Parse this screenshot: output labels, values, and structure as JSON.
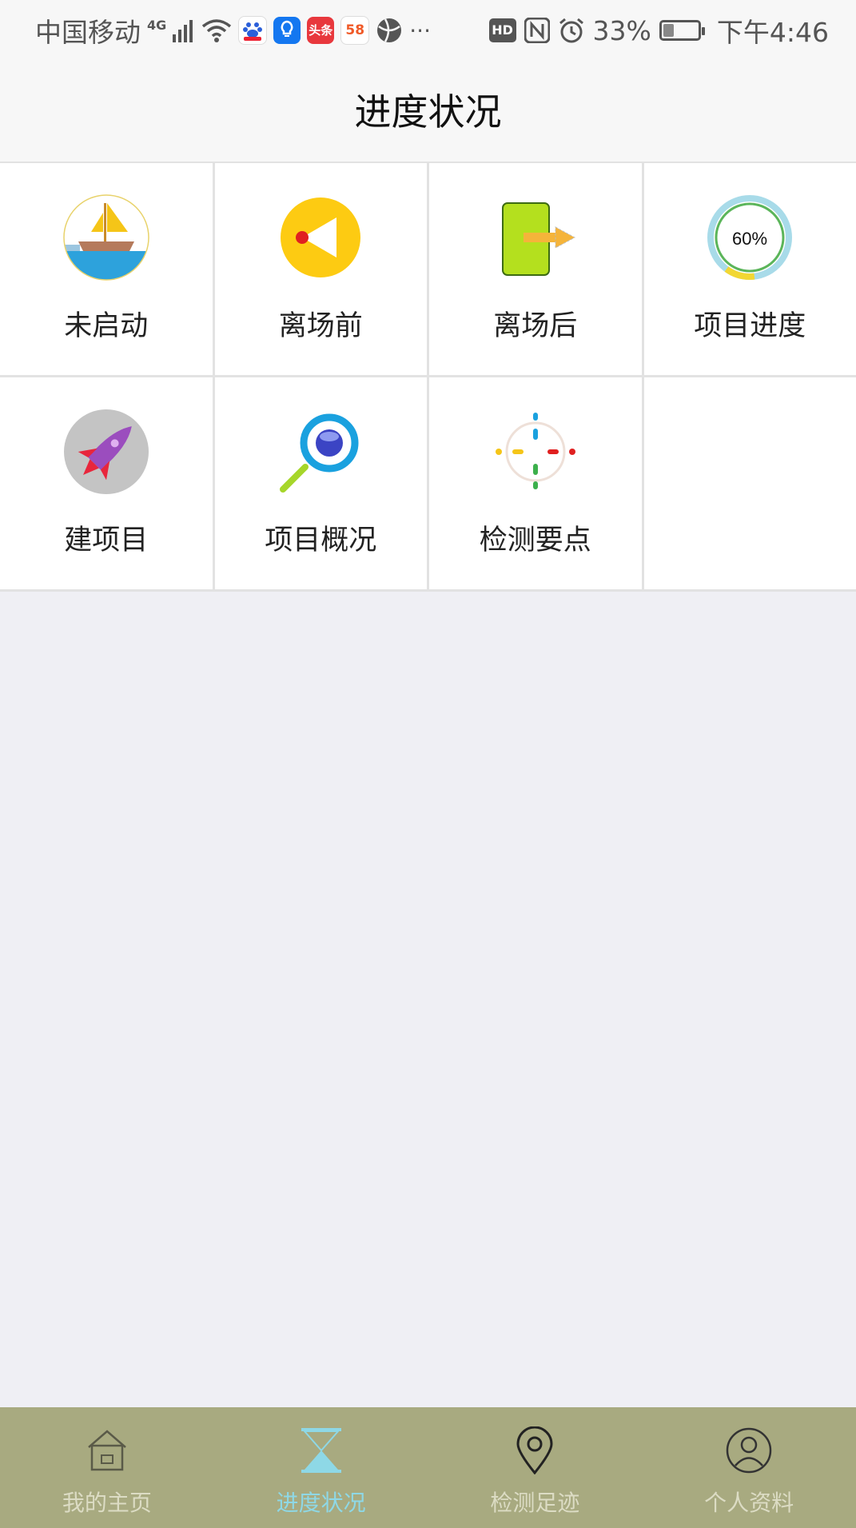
{
  "status_bar": {
    "carrier": "中国移动",
    "network": "4G",
    "more": "···",
    "hd": "HD",
    "battery_percent": "33%",
    "battery_level": 0.33,
    "time": "下午4:46",
    "app_icons": [
      "baidu-icon",
      "bulb-icon",
      "toutiao-icon",
      "58-icon",
      "browser-icon"
    ],
    "icon_texts": {
      "toutiao": "头条",
      "58": "58"
    }
  },
  "header": {
    "title": "进度状况"
  },
  "grid": {
    "items": [
      {
        "label": "未启动",
        "icon": "sailboat-icon"
      },
      {
        "label": "离场前",
        "icon": "flag-circle-icon"
      },
      {
        "label": "离场后",
        "icon": "exit-door-icon"
      },
      {
        "label": "项目进度",
        "icon": "progress-ring-icon",
        "icon_text": "60%",
        "progress": 0.6
      },
      {
        "label": "建项目",
        "icon": "rocket-icon"
      },
      {
        "label": "项目概况",
        "icon": "magnifier-icon"
      },
      {
        "label": "检测要点",
        "icon": "crosshair-icon"
      }
    ]
  },
  "tab_bar": {
    "active_index": 1,
    "colors": {
      "background": "#a8aa80",
      "active": "#8ed8e6",
      "inactive": "#dcdcc4"
    },
    "tabs": [
      {
        "label": "我的主页",
        "icon": "home-icon"
      },
      {
        "label": "进度状况",
        "icon": "hourglass-icon"
      },
      {
        "label": "检测足迹",
        "icon": "location-pin-icon"
      },
      {
        "label": "个人资料",
        "icon": "user-icon"
      }
    ]
  }
}
